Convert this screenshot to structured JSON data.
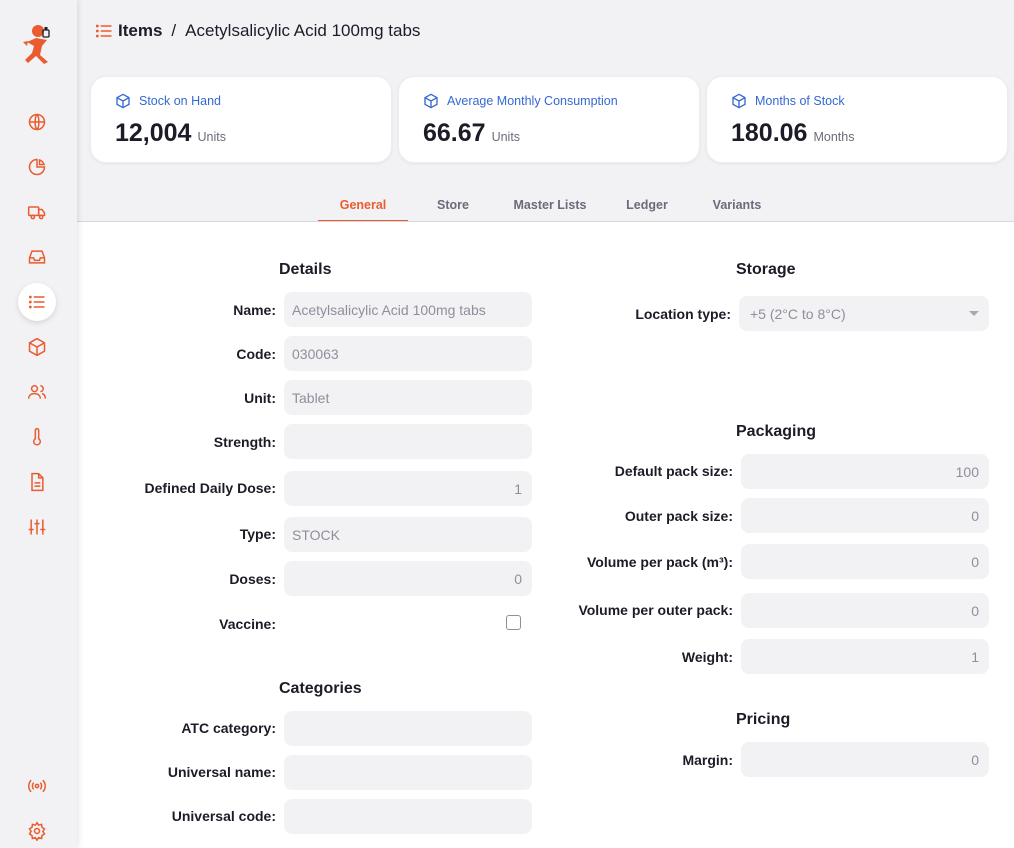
{
  "breadcrumb": {
    "root": "Items",
    "separator": "/",
    "current": "Acetylsalicylic Acid 100mg tabs"
  },
  "stats": [
    {
      "label": "Stock on Hand",
      "value": "12,004",
      "unit": "Units",
      "icon": "package-icon"
    },
    {
      "label": "Average Monthly Consumption",
      "value": "66.67",
      "unit": "Units",
      "icon": "package-icon"
    },
    {
      "label": "Months of Stock",
      "value": "180.06",
      "unit": "Months",
      "icon": "package-icon"
    }
  ],
  "tabs": [
    {
      "label": "General",
      "active": true
    },
    {
      "label": "Store",
      "active": false
    },
    {
      "label": "Master Lists",
      "active": false
    },
    {
      "label": "Ledger",
      "active": false
    },
    {
      "label": "Variants",
      "active": false
    }
  ],
  "sidebar": {
    "items": [
      {
        "icon": "globe-icon",
        "active": false
      },
      {
        "icon": "pie-chart-icon",
        "active": false
      },
      {
        "icon": "truck-icon",
        "active": false
      },
      {
        "icon": "inbox-icon",
        "active": false
      },
      {
        "icon": "list-icon",
        "active": true
      },
      {
        "icon": "cube-icon",
        "active": false
      },
      {
        "icon": "users-icon",
        "active": false
      },
      {
        "icon": "thermometer-icon",
        "active": false
      },
      {
        "icon": "document-icon",
        "active": false
      },
      {
        "icon": "sliders-icon",
        "active": false
      }
    ],
    "bottom": [
      {
        "icon": "broadcast-icon"
      },
      {
        "icon": "settings-icon"
      }
    ]
  },
  "details": {
    "title": "Details",
    "fields": [
      {
        "label": "Name:",
        "value": "Acetylsalicylic Acid 100mg tabs"
      },
      {
        "label": "Code:",
        "value": "030063"
      },
      {
        "label": "Unit:",
        "value": "Tablet"
      },
      {
        "label": "Strength:",
        "value": ""
      },
      {
        "label": "Defined Daily Dose:",
        "value": "1"
      },
      {
        "label": "Type:",
        "value": "STOCK"
      },
      {
        "label": "Doses:",
        "value": "0"
      },
      {
        "label": "Vaccine:",
        "value": ""
      }
    ]
  },
  "categories": {
    "title": "Categories",
    "fields": [
      {
        "label": "ATC category:",
        "value": ""
      },
      {
        "label": "Universal name:",
        "value": ""
      },
      {
        "label": "Universal code:",
        "value": ""
      }
    ]
  },
  "storage": {
    "title": "Storage",
    "location_label": "Location type:",
    "location_value": "+5 (2°C to 8°C)"
  },
  "packaging": {
    "title": "Packaging",
    "fields": [
      {
        "label": "Default pack size:",
        "value": "100"
      },
      {
        "label": "Outer pack size:",
        "value": "0"
      },
      {
        "label": "Volume per pack (m³):",
        "value": "0"
      },
      {
        "label": "Volume per outer pack:",
        "value": "0"
      },
      {
        "label": "Weight:",
        "value": "1"
      }
    ]
  },
  "pricing": {
    "title": "Pricing",
    "margin_label": "Margin:",
    "margin_value": "0"
  },
  "colors": {
    "accent": "#e95c30",
    "link": "#3568d4",
    "input_bg": "#f2f2f5"
  }
}
